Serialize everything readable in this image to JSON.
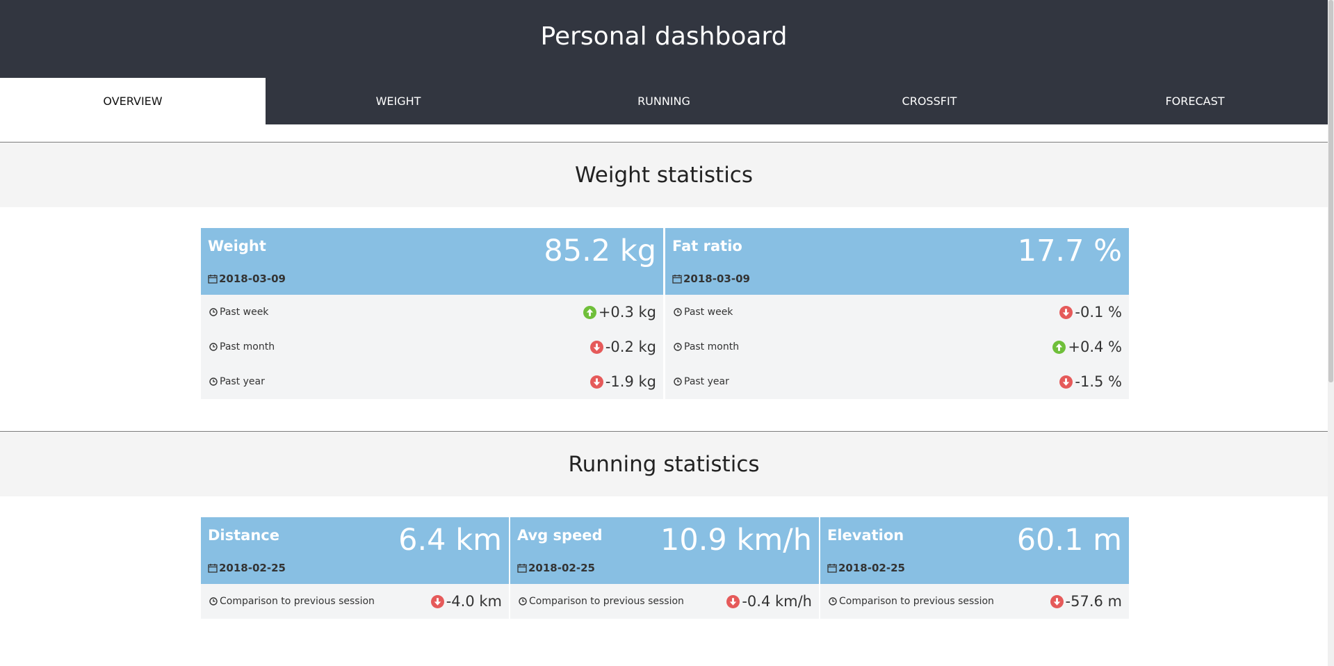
{
  "header": {
    "title": "Personal dashboard"
  },
  "nav": {
    "tabs": [
      {
        "label": "OVERVIEW",
        "active": true
      },
      {
        "label": "WEIGHT",
        "active": false
      },
      {
        "label": "RUNNING",
        "active": false
      },
      {
        "label": "CROSSFIT",
        "active": false
      },
      {
        "label": "FORECAST",
        "active": false
      }
    ]
  },
  "colors": {
    "header_bg": "#323640",
    "card_head": "#88bfe3",
    "up": "#6fbf3a",
    "down": "#e55a5a"
  },
  "weight": {
    "title": "Weight statistics",
    "cards": [
      {
        "label": "Weight",
        "value": "85.2 kg",
        "date": "2018-03-09",
        "rows": [
          {
            "label": "Past week",
            "delta": "+0.3 kg",
            "direction": "up"
          },
          {
            "label": "Past month",
            "delta": "-0.2 kg",
            "direction": "down"
          },
          {
            "label": "Past year",
            "delta": "-1.9 kg",
            "direction": "down"
          }
        ]
      },
      {
        "label": "Fat ratio",
        "value": "17.7 %",
        "date": "2018-03-09",
        "rows": [
          {
            "label": "Past week",
            "delta": "-0.1 %",
            "direction": "down"
          },
          {
            "label": "Past month",
            "delta": "+0.4 %",
            "direction": "up"
          },
          {
            "label": "Past year",
            "delta": "-1.5 %",
            "direction": "down"
          }
        ]
      }
    ]
  },
  "running": {
    "title": "Running statistics",
    "cards": [
      {
        "label": "Distance",
        "value": "6.4 km",
        "date": "2018-02-25",
        "rows": [
          {
            "label": "Comparison to previous session",
            "delta": "-4.0 km",
            "direction": "down"
          }
        ]
      },
      {
        "label": "Avg speed",
        "value": "10.9 km/h",
        "date": "2018-02-25",
        "rows": [
          {
            "label": "Comparison to previous session",
            "delta": "-0.4 km/h",
            "direction": "down"
          }
        ]
      },
      {
        "label": "Elevation",
        "value": "60.1 m",
        "date": "2018-02-25",
        "rows": [
          {
            "label": "Comparison to previous session",
            "delta": "-57.6 m",
            "direction": "down"
          }
        ]
      }
    ]
  }
}
